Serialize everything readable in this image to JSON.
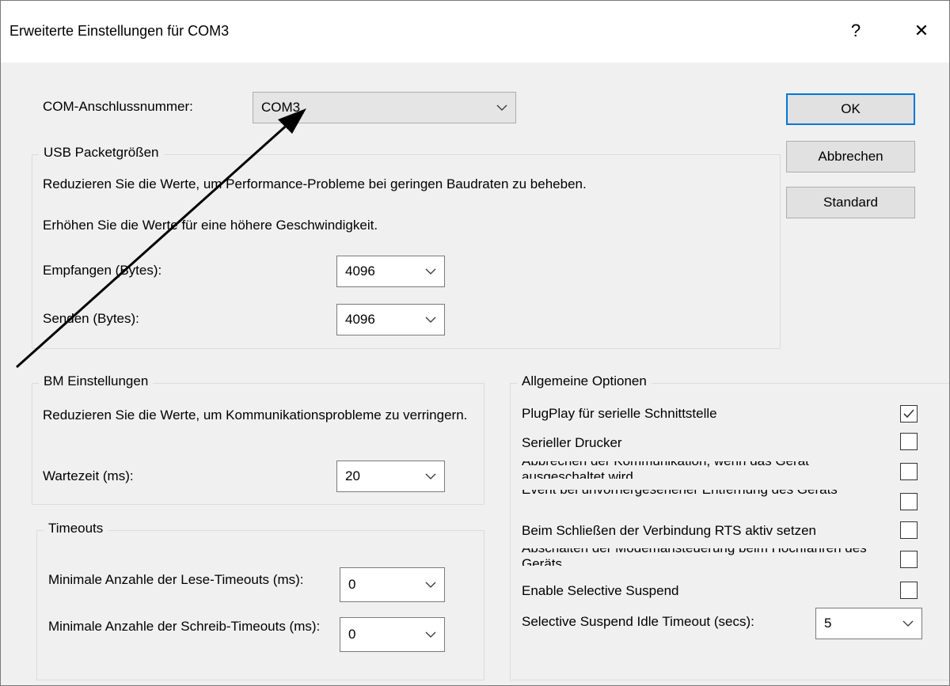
{
  "window": {
    "title": "Erweiterte Einstellungen für COM3",
    "help_label": "?",
    "close_label": "✕"
  },
  "com_port": {
    "label": "COM-Anschlussnummer:",
    "value": "COM3"
  },
  "buttons": {
    "ok": "OK",
    "cancel": "Abbrechen",
    "standard": "Standard"
  },
  "usb": {
    "legend": "USB Packetgrößen",
    "desc1": "Reduzieren Sie die Werte, um Performance-Probleme bei geringen Baudraten zu beheben.",
    "desc2": "Erhöhen Sie die Werte für eine höhere Geschwindigkeit.",
    "receive_label": "Empfangen (Bytes):",
    "receive_value": "4096",
    "send_label": "Senden (Bytes):",
    "send_value": "4096"
  },
  "bm": {
    "legend": "BM Einstellungen",
    "desc": "Reduzieren Sie die Werte, um Kommunikationsprobleme zu verringern.",
    "latency_label": "Wartezeit (ms):",
    "latency_value": "20"
  },
  "timeouts": {
    "legend": "Timeouts",
    "read_label": "Minimale Anzahle der Lese-Timeouts (ms):",
    "read_value": "0",
    "write_label": "Minimale Anzahle der Schreib-Timeouts (ms):",
    "write_value": "0"
  },
  "options": {
    "legend": "Allgemeine Optionen",
    "plugplay": "PlugPlay für serielle Schnittstelle",
    "printer": "Serieller Drucker",
    "cancel_off": "Abbrechen der Kommunikation, wenn das Gerät ausgeschaltet wird",
    "surprise": "Event bei unvorhergesehener Entfernung des Geräts",
    "rts": "Beim Schließen der Verbindung RTS aktiv setzen",
    "modem": "Abschalten der Modemansteuerung beim Hochfahren des Geräts",
    "selective": "Enable Selective Suspend",
    "idle_label": "Selective Suspend Idle Timeout (secs):",
    "idle_value": "5"
  },
  "checkbox_states": {
    "plugplay": true,
    "printer": false,
    "cancel_off": false,
    "surprise": false,
    "rts": false,
    "modem": false,
    "selective": false
  }
}
